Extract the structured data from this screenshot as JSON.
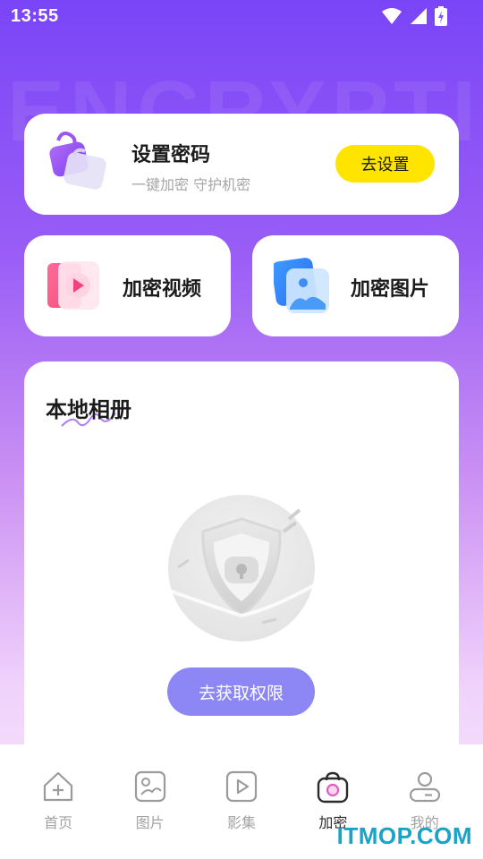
{
  "status_bar": {
    "time": "13:55"
  },
  "background_watermark": "ENCRYPTION",
  "password_card": {
    "title": "设置密码",
    "subtitle": "一键加密 守护机密",
    "button_label": "去设置",
    "icon": "lock-bag-icon"
  },
  "quick_actions": [
    {
      "label": "加密视频",
      "icon": "video-play-icon"
    },
    {
      "label": "加密图片",
      "icon": "image-icon"
    }
  ],
  "album": {
    "title": "本地相册",
    "empty_icon": "shield-lock-icon",
    "button_label": "去获取权限"
  },
  "tabbar": [
    {
      "label": "首页",
      "icon": "home-icon",
      "active": false
    },
    {
      "label": "图片",
      "icon": "picture-icon",
      "active": false
    },
    {
      "label": "影集",
      "icon": "play-icon",
      "active": false
    },
    {
      "label": "加密",
      "icon": "lock-bag-icon",
      "active": true
    },
    {
      "label": "我的",
      "icon": "user-icon",
      "active": false
    }
  ],
  "watermark": "ITMOP.COM",
  "colors": {
    "accent_yellow": "#ffe400",
    "primary_purple": "#8d87f6",
    "gradient_top": "#7a45f7",
    "tab_active_ring": "#e35cc0"
  }
}
